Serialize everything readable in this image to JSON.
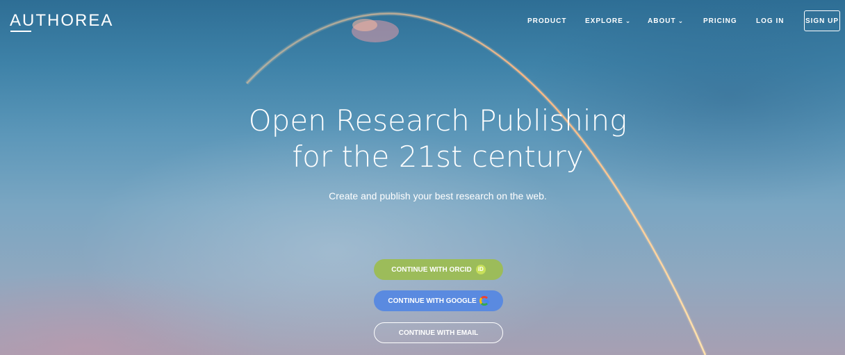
{
  "brand": {
    "logo": "AUTHOREA"
  },
  "nav": {
    "product": "PRODUCT",
    "explore": "EXPLORE",
    "about": "ABOUT",
    "pricing": "PRICING",
    "login": "LOG IN",
    "signup": "SIGN UP"
  },
  "icons": {
    "chevron": "chevron-down-icon",
    "orcid": "orcid-icon",
    "google": "google-icon"
  },
  "hero": {
    "line1": "Open Research Publishing",
    "line2": "for the 21st century",
    "subtitle": "Create and publish your best research on the web."
  },
  "buttons": {
    "orcid": "CONTINUE WITH ORCID",
    "orcid_badge": "iD",
    "google": "CONTINUE WITH GOOGLE",
    "email": "CONTINUE WITH EMAIL"
  },
  "colors": {
    "orcid_button": "#9cbc5a",
    "google_button": "#5a8ae0",
    "trail": "#ffb27a"
  }
}
